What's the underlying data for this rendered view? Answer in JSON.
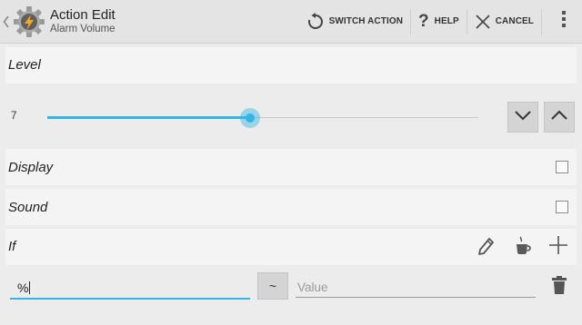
{
  "header": {
    "title": "Action Edit",
    "subtitle": "Alarm Volume",
    "switch_action_label": "SWITCH ACTION",
    "help_label": "HELP",
    "cancel_label": "CANCEL"
  },
  "level": {
    "label": "Level",
    "value": "7",
    "slider_fraction": 0.47
  },
  "display": {
    "label": "Display",
    "checked": false
  },
  "sound": {
    "label": "Sound",
    "checked": false
  },
  "if_section": {
    "label": "If"
  },
  "condition": {
    "left_value": "%",
    "operator": "~",
    "value_placeholder": "Value"
  },
  "colors": {
    "accent": "#33b5e5",
    "action_bar": "#e4e4e4",
    "section_bg": "#f4f4f4",
    "page_bg": "#ececec"
  },
  "icons": [
    "back-chevron-icon",
    "app-icon",
    "refresh-icon",
    "help-icon",
    "close-icon",
    "overflow-menu-icon",
    "chevron-down-icon",
    "chevron-up-icon",
    "pencil-icon",
    "coffee-cup-icon",
    "plus-icon",
    "trash-icon"
  ]
}
